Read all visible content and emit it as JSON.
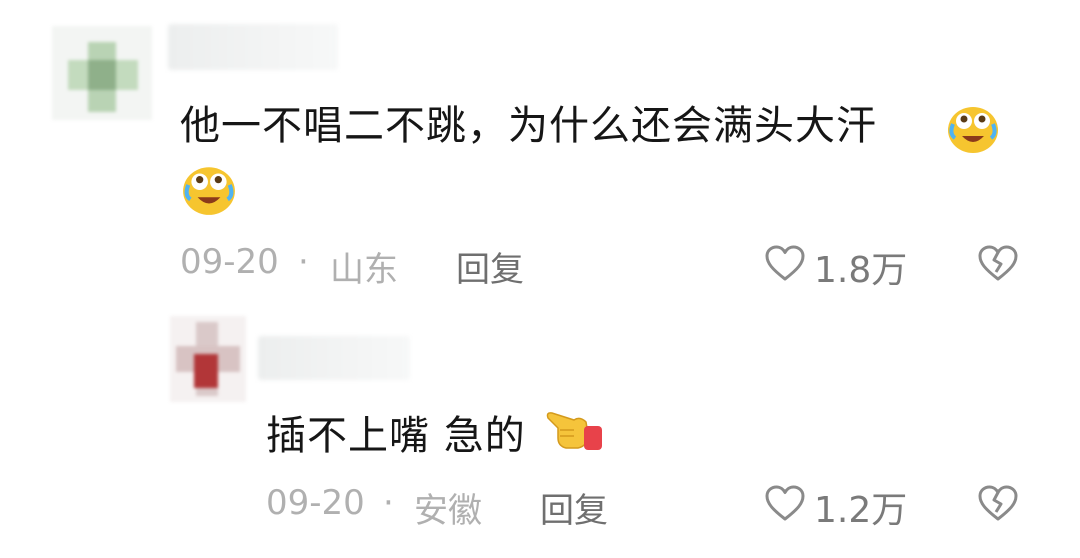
{
  "comments": [
    {
      "text": "他一不唱二不跳，为什么还会满头大汗",
      "emoji": "crying-laughing-emoji",
      "date": "09-20",
      "separator": "·",
      "location": "山东",
      "reply_label": "回复",
      "likes": "1.8万"
    },
    {
      "text": "插不上嘴 急的",
      "emoji": "pointing-hand-emoji",
      "date": "09-20",
      "separator": "·",
      "location": "安徽",
      "reply_label": "回复",
      "likes": "1.2万"
    }
  ],
  "icons": {
    "like": "heart-outline-icon",
    "dislike": "broken-heart-icon"
  },
  "colors": {
    "text": "#161616",
    "meta": "#b0b0b0",
    "reply": "#6f6f6f",
    "icon": "#8a8a8a",
    "emoji_face": "#f6c52f"
  }
}
